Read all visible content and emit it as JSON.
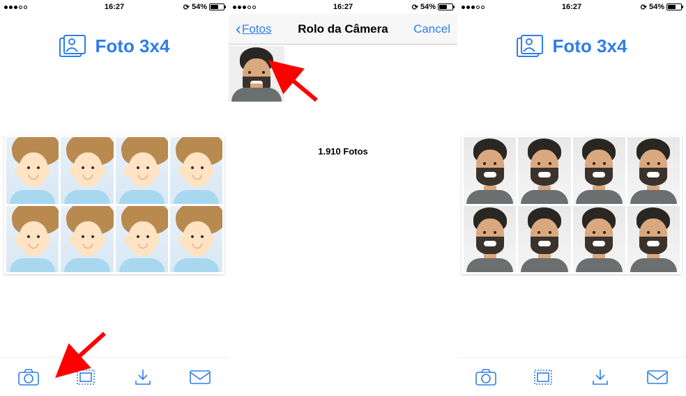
{
  "status": {
    "time_left": "16:27",
    "time_mid": "16:27",
    "time_right": "16:27",
    "battery_pct_left": "54%",
    "battery_pct_mid": "54%",
    "battery_pct_right": "54%",
    "rotate_indicator": "⟳"
  },
  "app": {
    "title": "Foto 3x4",
    "logo_name": "photo-stack-icon"
  },
  "picker": {
    "back_label": "Fotos",
    "title": "Rolo da Câmera",
    "cancel_label": "Cancel",
    "count_label": "1.910 Fotos"
  },
  "toolbar": {
    "camera": "camera-icon",
    "gallery": "gallery-icon",
    "download": "download-icon",
    "mail": "mail-icon"
  },
  "colors": {
    "accent": "#2e7de9",
    "arrow": "#ff0000"
  }
}
